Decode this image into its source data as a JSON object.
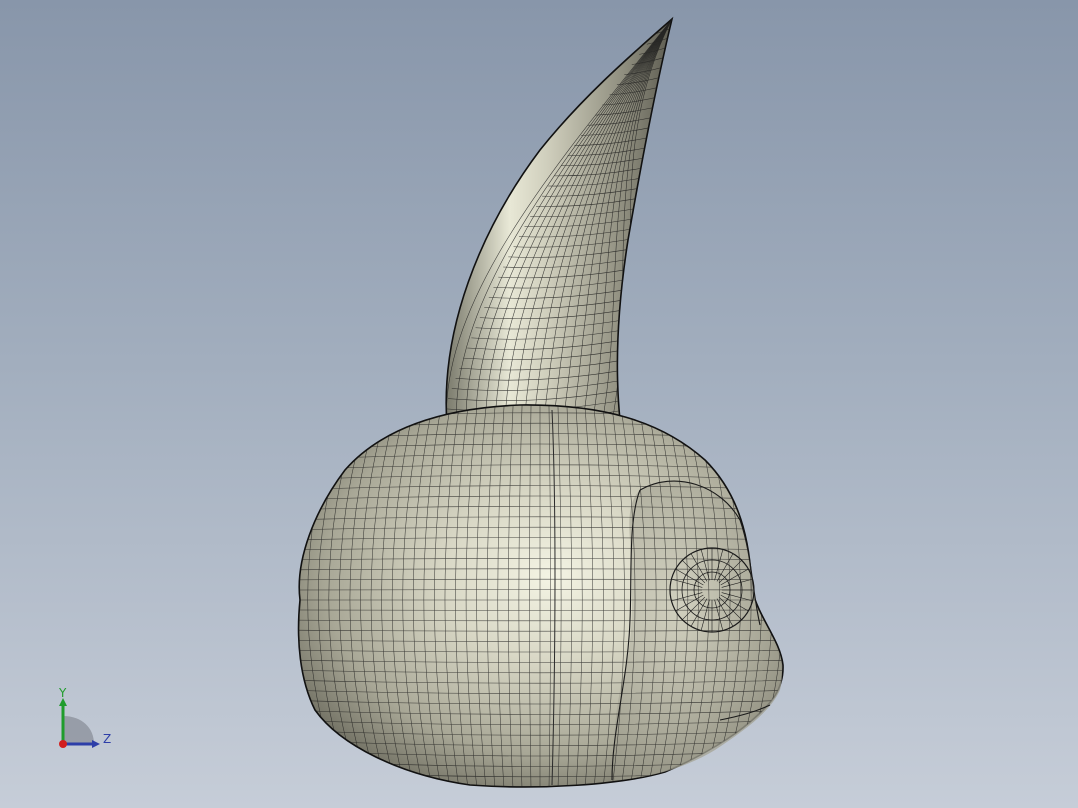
{
  "viewport": {
    "background_top": "#8896aa",
    "background_bottom": "#c6cdd8"
  },
  "model": {
    "name_icon": "horned-head-mesh-model",
    "surface_color": "#c9c8b8",
    "highlight_color": "#f6f6e8",
    "wire_color": "#1c1c1c"
  },
  "triad": {
    "y_label": "Y",
    "z_label": "Z",
    "x_color": "#d21e1e",
    "y_color": "#1f9c2c",
    "z_color": "#2d3ea8"
  }
}
